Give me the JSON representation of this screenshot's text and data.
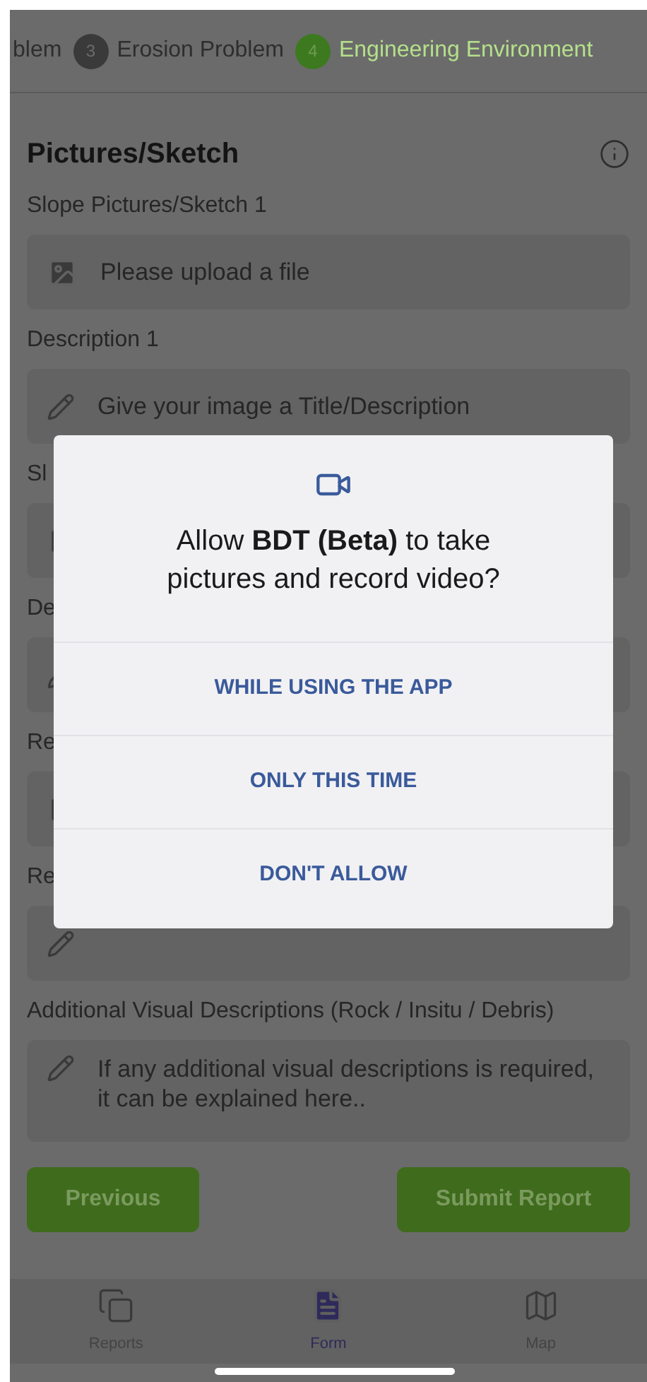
{
  "steps": [
    {
      "label": "blem",
      "active": false
    },
    {
      "number": "3",
      "label": "Erosion Problem",
      "active": false
    },
    {
      "number": "4",
      "label": "Engineering Environment",
      "active": true
    }
  ],
  "section": {
    "title": "Pictures/Sketch"
  },
  "fields": [
    {
      "label": "Slope Pictures/Sketch 1",
      "kind": "upload",
      "placeholder": "Please upload a file"
    },
    {
      "label": "Description 1",
      "kind": "text",
      "placeholder": "Give your image a Title/Description"
    },
    {
      "label": "Sl",
      "kind": "upload"
    },
    {
      "label": "De",
      "kind": "text"
    },
    {
      "label": "Re",
      "kind": "upload"
    },
    {
      "label": "Re",
      "kind": "text"
    },
    {
      "label": "Additional Visual Descriptions (Rock / Insitu / Debris)",
      "kind": "multiline",
      "placeholder": "If any additional visual descriptions is required, it can be explained here.."
    }
  ],
  "buttons": {
    "previous": "Previous",
    "submit": "Submit Report"
  },
  "nav": [
    {
      "label": "Reports",
      "selected": false
    },
    {
      "label": "Form",
      "selected": true
    },
    {
      "label": "Map",
      "selected": false
    }
  ],
  "dialog": {
    "question": "Allow **BDT (Beta)** to take pictures and record video?",
    "options": [
      "WHILE USING THE APP",
      "ONLY THIS TIME",
      "DON'T ALLOW"
    ]
  }
}
